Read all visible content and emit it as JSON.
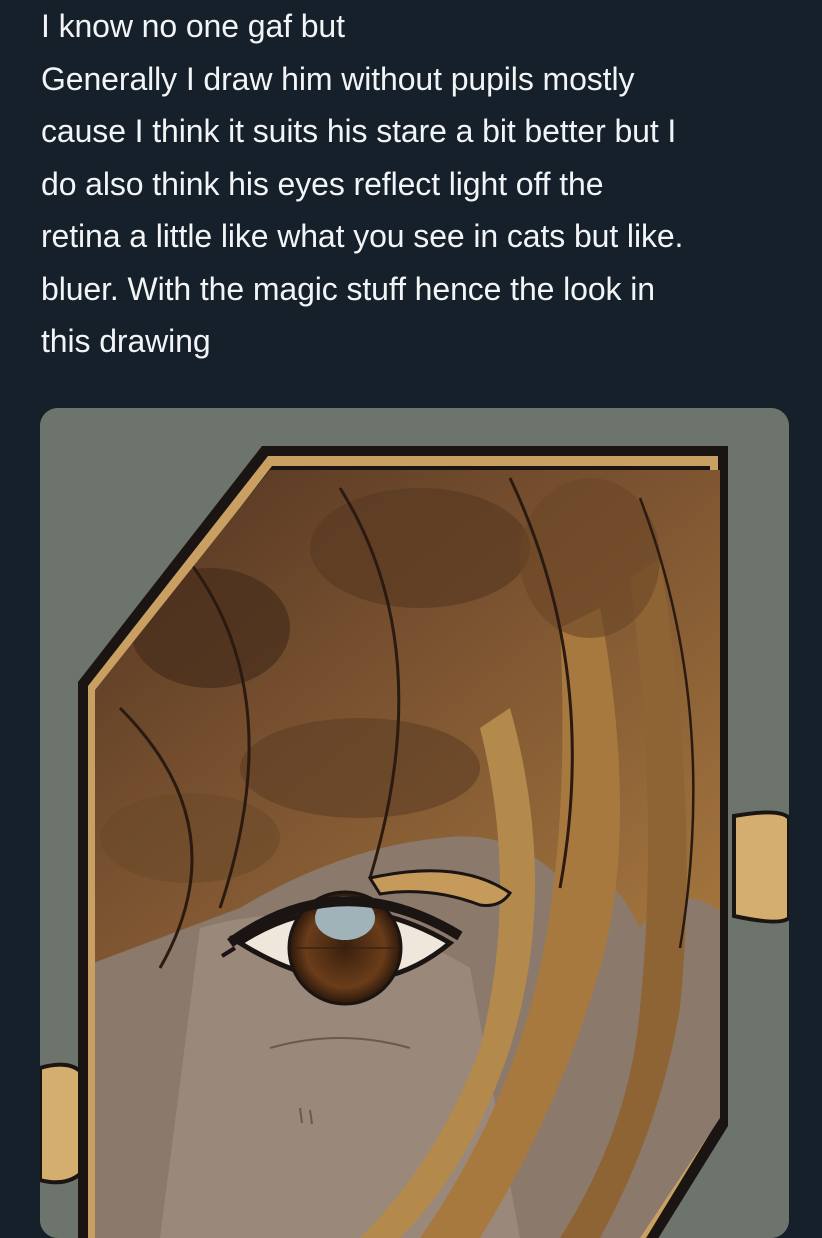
{
  "tweet": {
    "lines": [
      "I know no one gaf but",
      "Generally I draw him without pupils mostly",
      "cause I think it suits his stare a bit better but I",
      "do also think his eyes reflect light off the",
      "retina a little like what you see in cats but like.",
      "bluer. With the magic stuff hence the look in",
      "this drawing"
    ]
  },
  "media": {
    "icon": "artwork-image",
    "colors": {
      "background": "#6d746c",
      "frame_gold": "#c9a062",
      "frame_outline": "#1a1412",
      "hair_dark": "#5a3a22",
      "hair_mid": "#8a6034",
      "hair_light": "#b0834a",
      "skin": "#8b7a6c",
      "iris": "#5c3416",
      "eye_highlight": "#9fb3b8"
    }
  },
  "theme": {
    "page_background": "#15202b",
    "text_color": "#f2f4f6"
  }
}
